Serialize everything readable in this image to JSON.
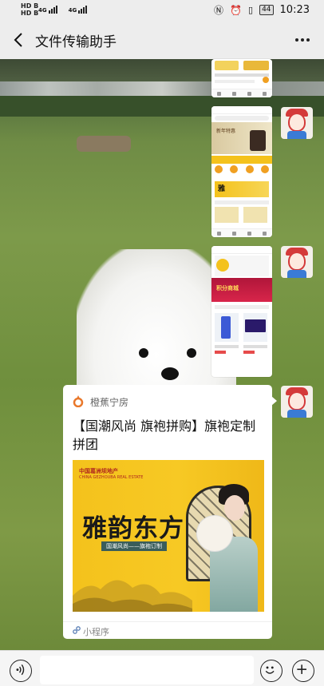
{
  "status_bar": {
    "carrier_top": "HD B",
    "carrier_bottom": "HD B",
    "network1": "4G",
    "network2": "4G",
    "battery": "44",
    "time": "10:23"
  },
  "header": {
    "title": "文件传输助手"
  },
  "card": {
    "brand": "橙蕉宁房",
    "title": "【国潮风尚 旗袍拼购】旗袍定制拼团",
    "cover_company": "中国葛洲坝地产",
    "cover_company_en": "CHINA GEZHOUBA REAL ESTATE",
    "cover_headline": "雅韵东方",
    "cover_subtitle": "国潮风尚——旗袍订制",
    "footer_label": "小程序"
  },
  "shots": [
    {
      "label": "我的订单"
    },
    {
      "label": "新年特惠 "
    },
    {
      "label": "积分商城"
    }
  ],
  "colors": {
    "accent": "#f6c322",
    "brand_orange": "#e9782b",
    "background": "#ededed"
  }
}
